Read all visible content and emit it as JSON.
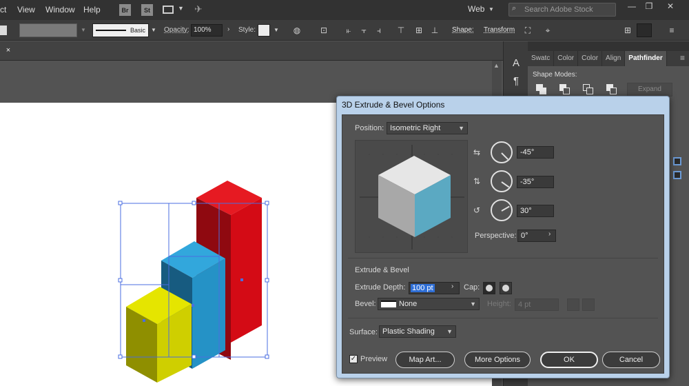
{
  "menubar": {
    "items": [
      "ct",
      "View",
      "Window",
      "Help"
    ],
    "bridge_icon": "Br",
    "stock_icon": "St",
    "workspace": "Web",
    "search_placeholder": "Search Adobe Stock"
  },
  "control_bar": {
    "stroke_label": "Basic",
    "opacity_label": "Opacity:",
    "opacity_value": "100%",
    "style_label": "Style:",
    "shape_label": "Shape:",
    "transform_label": "Transform"
  },
  "tab_close": "×",
  "pathfinder": {
    "tabs": [
      "Swatc",
      "Color",
      "Color",
      "Align",
      "Pathfinder"
    ],
    "shape_modes_label": "Shape Modes:",
    "expand_label": "Expand"
  },
  "dialog": {
    "title": "3D Extrude & Bevel Options",
    "position_label": "Position:",
    "position_value": "Isometric Right",
    "rotation_x": "-45°",
    "rotation_y": "-35°",
    "rotation_z": "30°",
    "perspective_label": "Perspective:",
    "perspective_value": "0°",
    "extrude_section": "Extrude & Bevel",
    "extrude_depth_label": "Extrude Depth:",
    "extrude_depth_value": "100 pt",
    "cap_label": "Cap:",
    "bevel_label": "Bevel:",
    "bevel_value": "None",
    "height_label": "Height:",
    "height_value": "4 pt",
    "surface_label": "Surface:",
    "surface_value": "Plastic Shading",
    "preview_label": "Preview",
    "preview_checked": true,
    "map_art_label": "Map Art...",
    "more_options_label": "More Options",
    "ok_label": "OK",
    "cancel_label": "Cancel"
  },
  "colors": {
    "bar_red": "#d40b15",
    "bar_blue": "#2592c6",
    "bar_yellow": "#cfcf00",
    "cube_face_right": "#5ba9c2",
    "selection": "#4a6ee0"
  }
}
